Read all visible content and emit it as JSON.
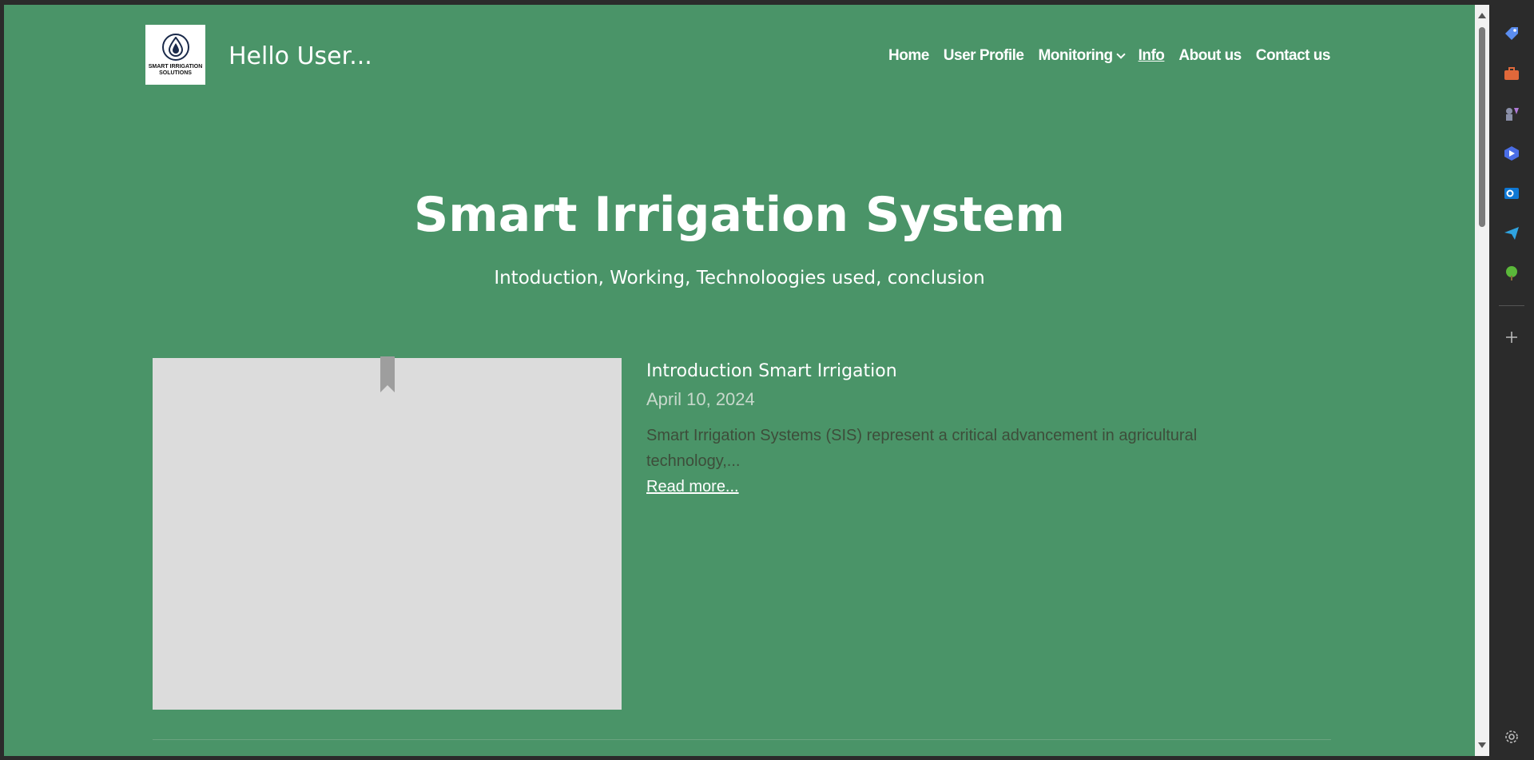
{
  "header": {
    "logo_text": "SMART IRRIGATION SOLUTIONS",
    "greeting": "Hello User..."
  },
  "nav": {
    "items": [
      {
        "label": "Home",
        "active": false
      },
      {
        "label": "User Profile",
        "active": false
      },
      {
        "label": "Monitoring",
        "active": false,
        "has_dropdown": true
      },
      {
        "label": "Info",
        "active": true
      },
      {
        "label": "About us",
        "active": false
      },
      {
        "label": "Contact us",
        "active": false
      }
    ]
  },
  "hero": {
    "title": "Smart Irrigation System",
    "subtitle": "Intoduction, Working, Technoloogies used, conclusion"
  },
  "post": {
    "title": "Introduction Smart Irrigation",
    "date": "April 10, 2024",
    "excerpt": "Smart Irrigation Systems (SIS) represent a critical advancement in agricultural technology,...",
    "read_more": "Read more..."
  },
  "colors": {
    "page_bg": "#4a9468",
    "thumb_bg": "#dcdcdc",
    "excerpt_text": "#3d4d3a"
  },
  "edge_sidebar": {
    "icons": [
      "tag-icon",
      "briefcase-icon",
      "games-icon",
      "copilot-icon",
      "outlook-icon",
      "send-icon",
      "tree-icon",
      "add-icon",
      "settings-icon"
    ]
  }
}
